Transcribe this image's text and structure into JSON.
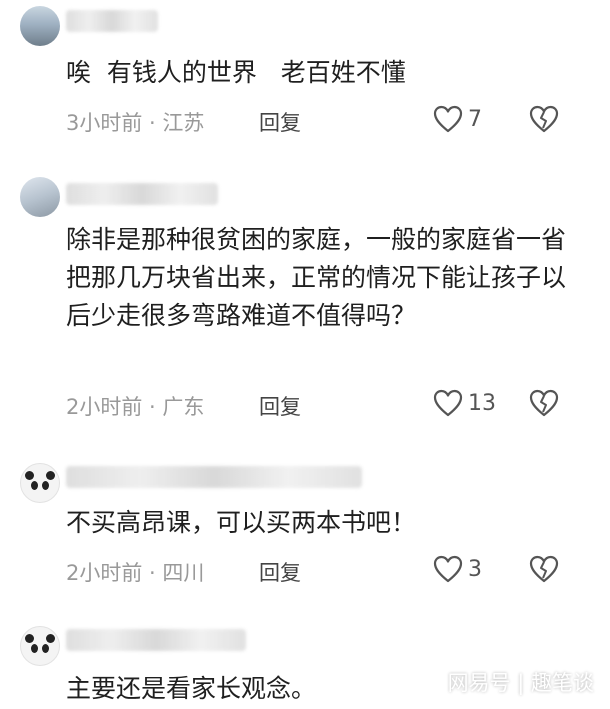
{
  "comments": [
    {
      "text": "唉  有钱人的世界   老百姓不懂",
      "meta": "3小时前 · 江苏",
      "reply_label": "回复",
      "likes": "7"
    },
    {
      "text": "除非是那种很贫困的家庭，一般的家庭省一省把那几万块省出来，正常的情况下能让孩子以后少走很多弯路难道不值得吗？",
      "meta": "2小时前 · 广东",
      "reply_label": "回复",
      "likes": "13"
    },
    {
      "text": "不买高昂课，可以买两本书吧！",
      "meta": "2小时前 · 四川",
      "reply_label": "回复",
      "likes": "3"
    },
    {
      "text": "主要还是看家长观念。"
    }
  ],
  "watermark": "网易号 | 趣笔谈",
  "icons": {
    "like": "heart-outline-icon",
    "dislike": "broken-heart-icon"
  },
  "colors": {
    "text": "#1f1f1f",
    "meta": "#999999",
    "icon": "#555555"
  }
}
